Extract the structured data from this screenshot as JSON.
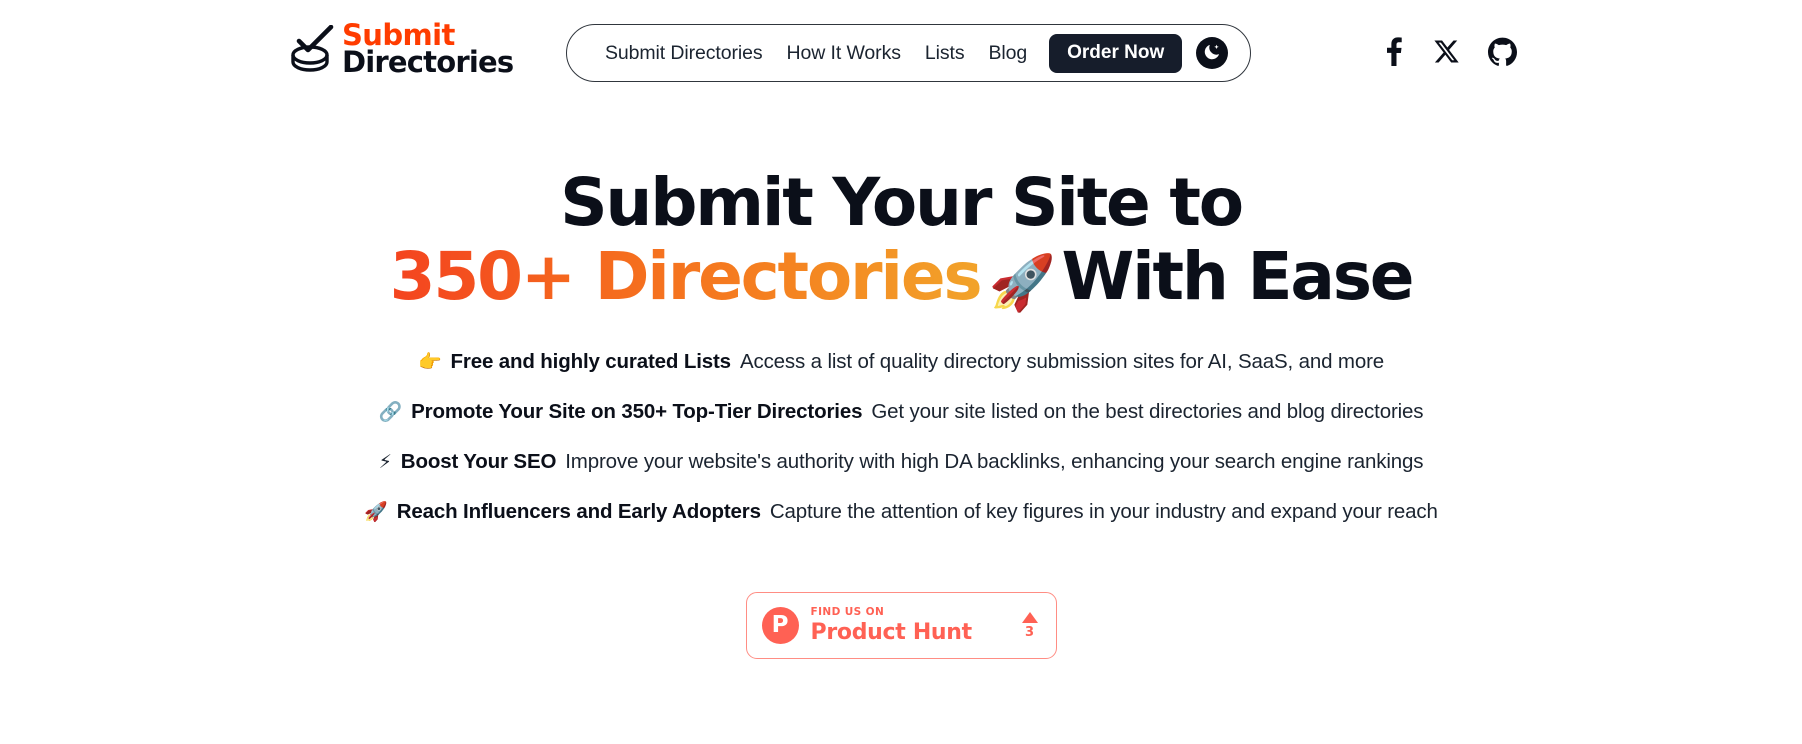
{
  "brand": {
    "logo_top": "Submit",
    "logo_bottom": "Directories",
    "logo_top_color": "#FF3C00",
    "logo_bottom_color": "#0b0f19"
  },
  "nav": {
    "items": [
      {
        "label": "Submit Directories"
      },
      {
        "label": "How It Works"
      },
      {
        "label": "Lists"
      },
      {
        "label": "Blog"
      }
    ],
    "cta_label": "Order Now",
    "cta_bg": "#161d2b",
    "theme_toggle_icon": "moon-icon"
  },
  "socials": [
    {
      "name": "facebook-icon",
      "label": "Facebook"
    },
    {
      "name": "x-twitter-icon",
      "label": "X"
    },
    {
      "name": "github-icon",
      "label": "GitHub"
    }
  ],
  "hero": {
    "line1": "Submit Your Site to",
    "count": "350+",
    "highlight": "Directories",
    "emoji": "🚀",
    "line2_tail": "With Ease",
    "gradient_start": "#F4441F",
    "gradient_end": "#F2A32A"
  },
  "features": [
    {
      "icon": "👉",
      "icon_name": "pointing-right-icon",
      "bold": "Free and highly curated Lists",
      "text": "Access a list of quality directory submission sites for AI, SaaS, and more"
    },
    {
      "icon": "🔗",
      "icon_name": "link-icon",
      "bold": "Promote Your Site on 350+ Top-Tier Directories",
      "text": "Get your site listed on the best directories and blog directories"
    },
    {
      "icon": "⚡",
      "icon_name": "lightning-icon",
      "bold": "Boost Your SEO",
      "text": "Improve your website's authority with high DA backlinks, enhancing your search engine rankings"
    },
    {
      "icon": "🚀",
      "icon_name": "rocket-icon",
      "bold": "Reach Influencers and Early Adopters",
      "text": "Capture the attention of key figures in your industry and expand your reach"
    }
  ],
  "product_hunt": {
    "logo_letter": "P",
    "kicker": "FIND US ON",
    "name": "Product Hunt",
    "upvote_count": "3",
    "color": "#FF6154"
  }
}
